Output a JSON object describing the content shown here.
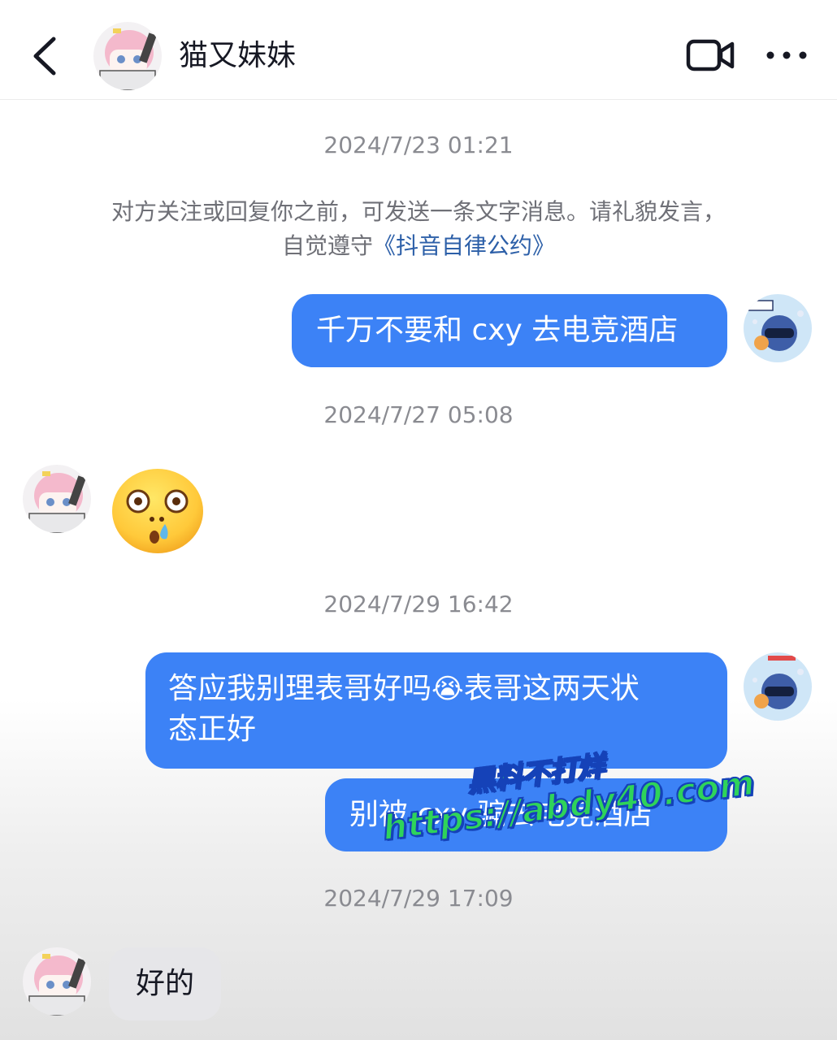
{
  "header": {
    "contact_name": "猫又妹妹",
    "back_icon": "chevron-left-icon",
    "video_icon": "video-camera-icon",
    "more_icon": "more-horizontal-icon"
  },
  "messages": {
    "ts1": "2024/7/23 01:21",
    "notice_line1": "对方关注或回复你之前，可发送一条文字消息。请礼貌发言，",
    "notice_line2_prefix": "自觉遵守",
    "notice_link": "《抖音自律公约》",
    "msg1": "千万不要和 cxy 去电竞酒店",
    "ts2": "2024/7/27 05:08",
    "msg2_emoji": "😮‍💧",
    "ts3": "2024/7/29 16:42",
    "msg3_part1": "答应我别理表哥好吗",
    "msg3_emoji": "😭",
    "msg3_part2": "表哥这两天状",
    "msg3_line2": "态正好",
    "msg4": "别被 cxy 骗去电竞酒店",
    "ts4": "2024/7/29 17:09",
    "msg5": "好的"
  },
  "watermark": {
    "line1": "黑料不打烊",
    "line2": "https://abdy40.com"
  },
  "colors": {
    "sent_bubble": "#3c82f6",
    "received_bubble": "#e6e6e9",
    "link": "#2c5fa8",
    "watermark_fill": "#2fd35a",
    "watermark_stroke": "#1542b8"
  }
}
